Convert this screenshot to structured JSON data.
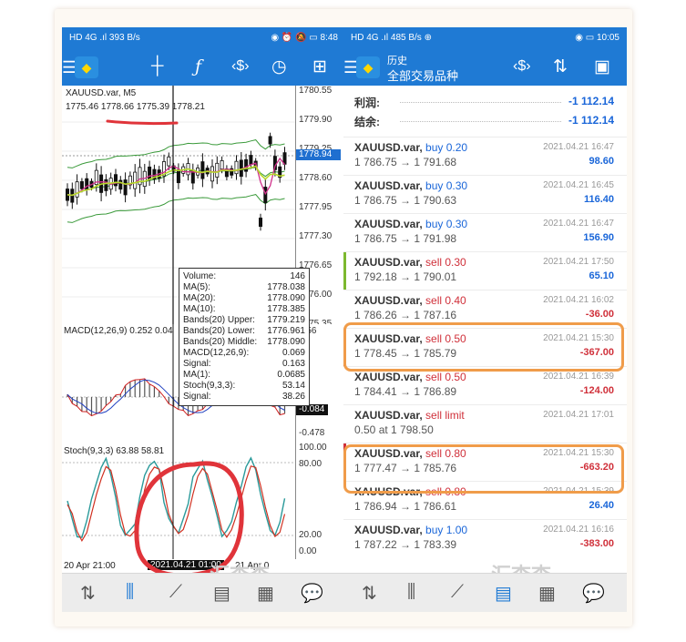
{
  "left": {
    "status_left": "HD 4G .ıl 393 B/s",
    "status_right": "◉ ⏰ 🔕 ▭ 8:48",
    "symbol_header": "XAUUSD.var, M5",
    "ohlc": "1775.46 1778.66 1775.39 1778.21",
    "price_ticks": [
      "1780.55",
      "1779.90",
      "1779.25",
      "1778.60",
      "1777.95",
      "1777.30",
      "1776.65",
      "1776.00",
      "1775.35"
    ],
    "current_price": "1778.94",
    "macd_header": "MACD(12,26,9) 0.252 0.04",
    "macd_ticks": [
      "0.56",
      "-0.478"
    ],
    "macd_current": "-0.084",
    "stoch_header": "Stoch(9,3,3) 63.88 58.81",
    "stoch_ticks": [
      "100.00",
      "80.00",
      "20.00",
      "0.00"
    ],
    "time_labels": [
      "20 Apr 21:00",
      "2021.04.21 01:00",
      "21 Apr 0"
    ],
    "tooltip": [
      {
        "k": "Volume:",
        "v": "146"
      },
      {
        "k": "MA(5):",
        "v": "1778.038"
      },
      {
        "k": "MA(20):",
        "v": "1778.090"
      },
      {
        "k": "MA(10):",
        "v": "1778.385"
      },
      {
        "k": "Bands(20) Upper:",
        "v": "1779.219"
      },
      {
        "k": "Bands(20) Lower:",
        "v": "1776.961"
      },
      {
        "k": "Bands(20) Middle:",
        "v": "1778.090"
      },
      {
        "k": "MACD(12,26,9):",
        "v": "0.069"
      },
      {
        "k": "Signal:",
        "v": "0.163"
      },
      {
        "k": "MA(1):",
        "v": "0.0685"
      },
      {
        "k": "Stoch(9,3,3):",
        "v": "53.14"
      },
      {
        "k": "Signal:",
        "v": "38.26"
      }
    ]
  },
  "right": {
    "status_left": "HD 4G .ıl 485 B/s ⊕",
    "status_right": "◉ ▭ 10:05",
    "title_top": "历史",
    "title_bottom": "全部交易品种",
    "profit_label": "利润:",
    "profit_value": "-1 112.14",
    "balance_label": "结余:",
    "balance_value": "-1 112.14",
    "trades": [
      {
        "sym": "XAUUSD.var,",
        "side": "buy 0.20",
        "type": "buy",
        "prices": "1 786.75 → 1 791.68",
        "date": "2021.04.21 16:47",
        "pl": "98.60"
      },
      {
        "sym": "XAUUSD.var,",
        "side": "buy 0.30",
        "type": "buy",
        "prices": "1 786.75 → 1 790.63",
        "date": "2021.04.21 16:45",
        "pl": "116.40"
      },
      {
        "sym": "XAUUSD.var,",
        "side": "buy 0.30",
        "type": "buy",
        "prices": "1 786.75 → 1 791.98",
        "date": "2021.04.21 16:47",
        "pl": "156.90"
      },
      {
        "sym": "XAUUSD.var,",
        "side": "sell 0.30",
        "type": "sell",
        "prices": "1 792.18 → 1 790.01",
        "date": "2021.04.21 17:50",
        "pl": "65.10",
        "bar": "#7cb82f"
      },
      {
        "sym": "XAUUSD.var,",
        "side": "sell 0.40",
        "type": "sell",
        "prices": "1 786.26 → 1 787.16",
        "date": "2021.04.21 16:02",
        "pl": "-36.00"
      },
      {
        "sym": "XAUUSD.var,",
        "side": "sell 0.50",
        "type": "sell",
        "prices": "1 778.45 → 1 785.79",
        "date": "2021.04.21 15:30",
        "pl": "-367.00",
        "bar": "#d0303a"
      },
      {
        "sym": "XAUUSD.var,",
        "side": "sell 0.50",
        "type": "sell",
        "prices": "1 784.41 → 1 786.89",
        "date": "2021.04.21 16:39",
        "pl": "-124.00"
      },
      {
        "sym": "XAUUSD.var,",
        "side": "sell limit",
        "type": "sell",
        "prices": "0.50 at 1 798.50",
        "date": "2021.04.21 17:01",
        "pl": ""
      },
      {
        "sym": "XAUUSD.var,",
        "side": "sell 0.80",
        "type": "sell",
        "prices": "1 777.47 → 1 785.76",
        "date": "2021.04.21 15:30",
        "pl": "-663.20",
        "bar": "#d0303a"
      },
      {
        "sym": "XAUUSD.var,",
        "side": "sell 0.80",
        "type": "sell",
        "prices": "1 786.94 → 1 786.61",
        "date": "2021.04.21 15:39",
        "pl": "26.40"
      },
      {
        "sym": "XAUUSD.var,",
        "side": "buy 1.00",
        "type": "buy",
        "prices": "1 787.22 → 1 783.39",
        "date": "2021.04.21 16:16",
        "pl": "-383.00"
      }
    ]
  },
  "watermark": "汇查查",
  "colors": {
    "accent": "#1f7ad4",
    "buy": "#1a66d9",
    "sell": "#d0303a",
    "highlight": "#f09c4a",
    "circle": "#e0343a"
  }
}
